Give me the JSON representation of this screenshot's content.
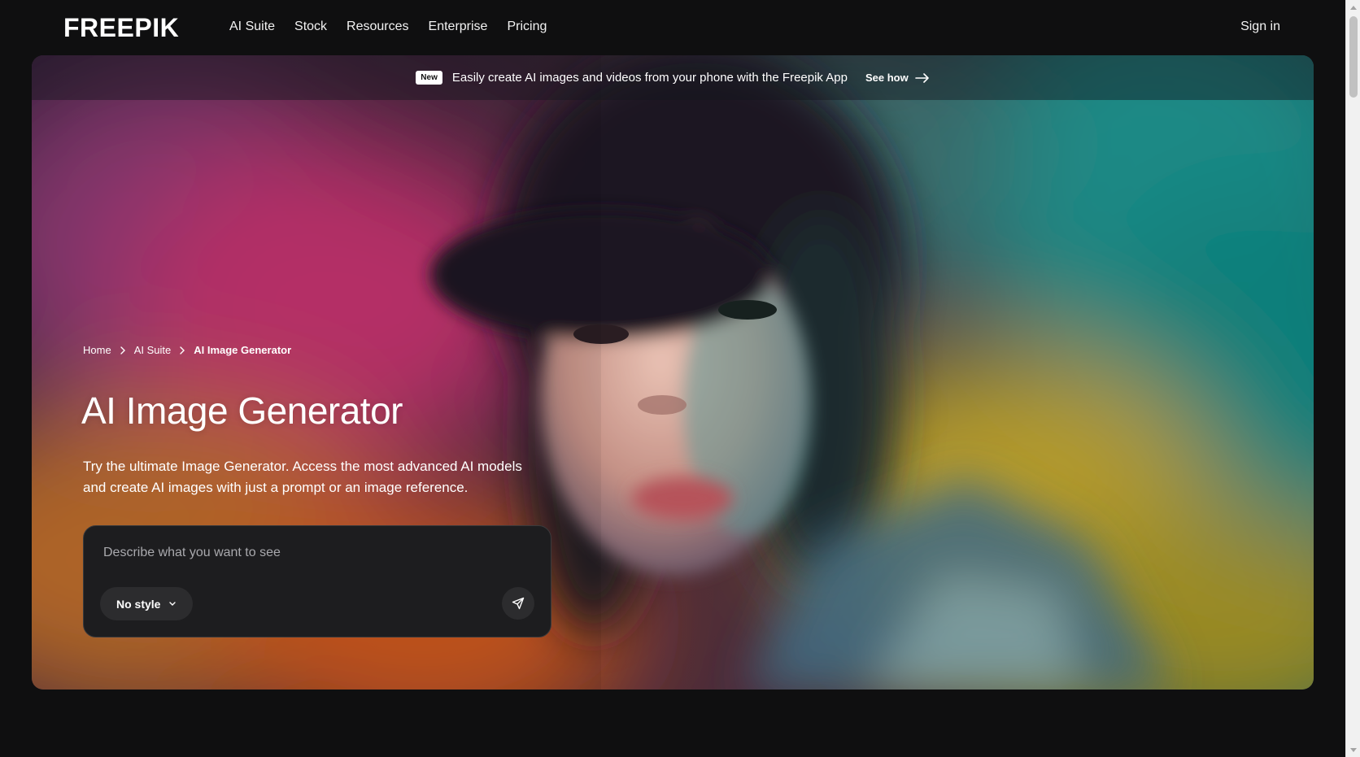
{
  "nav": {
    "logo": "FREEPIK",
    "links": [
      "AI Suite",
      "Stock",
      "Resources",
      "Enterprise",
      "Pricing"
    ],
    "sign_in": "Sign in"
  },
  "announcement": {
    "badge": "New",
    "text": "Easily create AI images and videos from your phone with the Freepik App",
    "cta": "See how"
  },
  "breadcrumb": [
    "Home",
    "AI Suite",
    "AI Image Generator"
  ],
  "hero": {
    "title": "AI Image Generator",
    "description": "Try the ultimate Image Generator. Access the most advanced AI models and create AI images with just a prompt or an image reference."
  },
  "prompt": {
    "placeholder": "Describe what you want to see",
    "style_label": "No style"
  },
  "icons": {
    "see_how_arrow": "arrow-right-icon",
    "breadcrumb_sep": "chevron-right-icon",
    "style_chevron": "chevron-down-icon",
    "send": "send-icon"
  },
  "colors": {
    "page_bg": "#0f0f10",
    "prompt_bg": "#1d1d1f",
    "pill_bg": "#2c2c2e"
  }
}
